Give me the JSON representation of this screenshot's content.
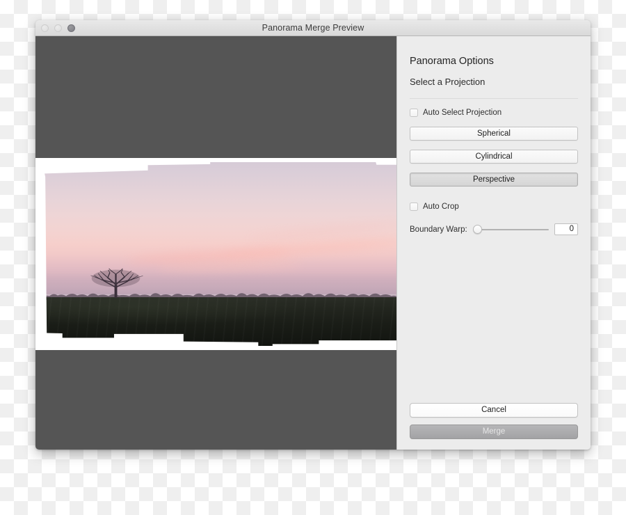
{
  "window": {
    "title": "Panorama Merge Preview",
    "traffic_lights": [
      {
        "name": "close",
        "state": "inactive"
      },
      {
        "name": "minimize",
        "state": "inactive"
      },
      {
        "name": "zoom",
        "state": "dark"
      }
    ]
  },
  "preview": {
    "background_color": "#555555",
    "canvas_background": "#ffffff",
    "description": "Stitched panorama preview of a dawn landscape: pink and lavender sky above a dark silhouetted treeline and an unlit green field. Irregular stitched edges along the top and bottom show unfilled white gaps."
  },
  "options": {
    "title": "Panorama Options",
    "subtitle": "Select a Projection",
    "auto_select": {
      "label": "Auto Select Projection",
      "checked": false
    },
    "projections": [
      {
        "label": "Spherical",
        "selected": false
      },
      {
        "label": "Cylindrical",
        "selected": false
      },
      {
        "label": "Perspective",
        "selected": true
      }
    ],
    "auto_crop": {
      "label": "Auto Crop",
      "checked": false
    },
    "boundary_warp": {
      "label": "Boundary Warp:",
      "value": "0",
      "min": "0",
      "max": "100",
      "percent": 0
    }
  },
  "footer": {
    "cancel_label": "Cancel",
    "merge_label": "Merge",
    "merge_enabled": false
  },
  "colors": {
    "panel_background": "#ececec",
    "preview_background": "#555555",
    "selected_button": "#d5d5d5",
    "disabled_button": "#a2a2a5",
    "sky_top": "#d6cbd7",
    "sky_glow": "#f6cfcb",
    "field": "#23261f"
  }
}
